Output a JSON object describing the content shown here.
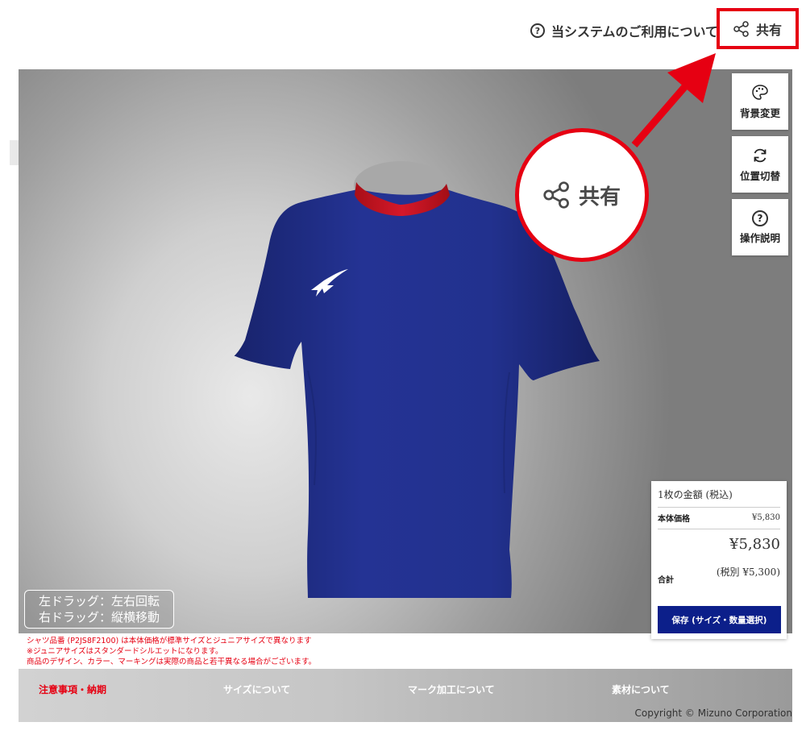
{
  "header": {
    "help_link": "当システムのご利用について",
    "share_label": "共有"
  },
  "viewer": {
    "side_buttons": [
      {
        "label": "背景変更",
        "icon": "palette-icon"
      },
      {
        "label": "位置切替",
        "icon": "refresh-icon"
      },
      {
        "label": "操作説明",
        "icon": "question-icon"
      }
    ],
    "callout_label": "共有",
    "drag_hint": {
      "line1": "左ドラッグ：左右回転",
      "line2": "右ドラッグ：縦横移動"
    }
  },
  "price": {
    "title": "1枚の金額 (税込)",
    "base_label": "本体価格",
    "base_value": "¥5,830",
    "total_label": "合計",
    "total_value": "¥5,830",
    "tax_excluded": "(税別 ¥5,300)",
    "save_button": "保存 (サイズ・数量選択)"
  },
  "notes": [
    "シャツ品番 (P2JS8F2100) は本体価格が標準サイズとジュニアサイズで異なります",
    "※ジュニアサイズはスタンダードシルエットになります。",
    "商品のデザイン、カラー、マーキングは実際の商品と若干異なる場合がございます。"
  ],
  "footer": {
    "links": [
      "注意事項・納期",
      "サイズについて",
      "マーク加工について",
      "素材について"
    ],
    "active_color": "#e60012",
    "copyright": "Copyright © Mizuno Corporation"
  },
  "colors": {
    "accent_red": "#e60012",
    "save_blue": "#0c1f8a",
    "shirt_navy": "#1f2d86",
    "collar_red": "#c8141e"
  }
}
